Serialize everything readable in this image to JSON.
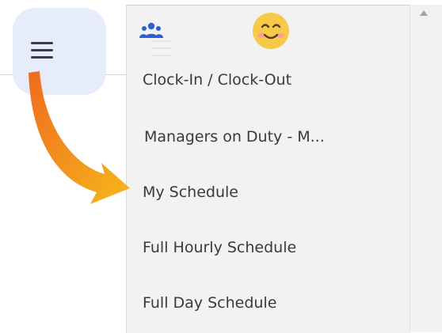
{
  "menu_button": {
    "icon": "hamburger-icon"
  },
  "drawer": {
    "header_icons": [
      "team-icon",
      "smiley-face-icon"
    ],
    "items": [
      {
        "label": "Clock-In / Clock-Out"
      },
      {
        "label": "Managers on Duty - M..."
      },
      {
        "label": "My Schedule"
      },
      {
        "label": "Full Hourly Schedule"
      },
      {
        "label": "Full Day Schedule"
      }
    ]
  },
  "annotation": {
    "icon": "orange-arrow-icon",
    "points_to": "My Schedule"
  },
  "colors": {
    "menu_button_bg": "#e6ecfc",
    "drawer_bg": "#f2f2f2",
    "team_icon": "#2b5fd9",
    "smiley": "#f7c948",
    "arrow_start": "#ef6a1e",
    "arrow_end": "#f6b81c"
  }
}
